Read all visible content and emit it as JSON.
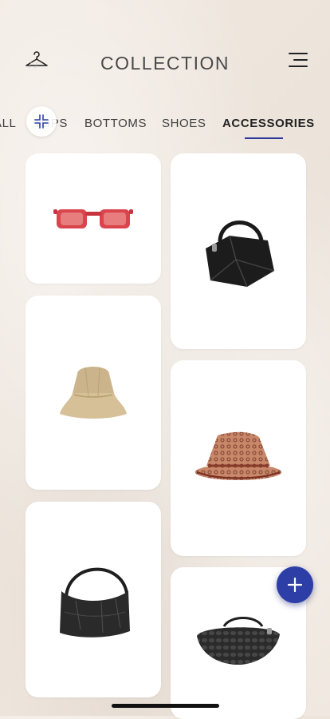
{
  "header": {
    "title": "COLLECTION",
    "left_icon": "hanger-icon",
    "right_icon": "menu-icon"
  },
  "tabs": [
    {
      "label": "ALL"
    },
    {
      "label": "TOPS"
    },
    {
      "label": "BOTTOMS"
    },
    {
      "label": "SHOES"
    },
    {
      "label": "ACCESSORIES",
      "active": true
    }
  ],
  "items": [
    {
      "name": "red sunglasses",
      "icon": "sunglasses-icon"
    },
    {
      "name": "black puzzle bag",
      "icon": "handbag-icon"
    },
    {
      "name": "beige bucket hat",
      "icon": "bucket-hat-icon"
    },
    {
      "name": "monogram sun hat",
      "icon": "sun-hat-icon"
    },
    {
      "name": "black hobo bag",
      "icon": "hobo-bag-icon"
    },
    {
      "name": "black woven bag",
      "icon": "woven-bag-icon"
    }
  ],
  "fab": {
    "label": "+"
  },
  "colors": {
    "accent": "#2d3ea6",
    "background": "#efe7df",
    "text": "#4a4a4a"
  }
}
